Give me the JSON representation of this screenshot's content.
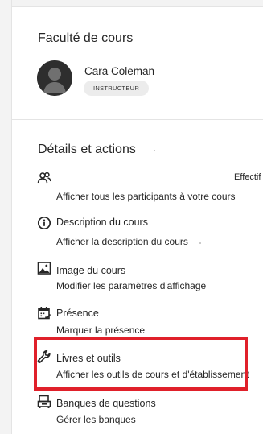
{
  "faculty": {
    "title": "Faculté de cours",
    "instructor": {
      "name": "Cara Coleman",
      "role": "INSTRUCTEUR",
      "avatar_icon": "person-silhouette"
    }
  },
  "details": {
    "title": "Détails et actions",
    "truncated_label": "Effectif",
    "items": [
      {
        "icon": "people-icon",
        "title": "",
        "desc": "Afficher tous les participants à votre cours"
      },
      {
        "icon": "info-icon",
        "title": "Description du cours",
        "desc": "Afficher la description du cours"
      },
      {
        "icon": "image-icon",
        "title": "Image du cours",
        "desc": "Modifier les paramètres d'affichage"
      },
      {
        "icon": "calendar-check-icon",
        "title": "Présence",
        "desc": "Marquer la présence"
      },
      {
        "icon": "wrench-icon",
        "title": "Livres et outils",
        "desc": "Afficher les outils de cours et d'établissement"
      },
      {
        "icon": "question-bank-icon",
        "title": "Banques de questions",
        "desc": "Gérer les banques"
      }
    ]
  },
  "annotation": {
    "highlight_color": "#e0202a"
  }
}
